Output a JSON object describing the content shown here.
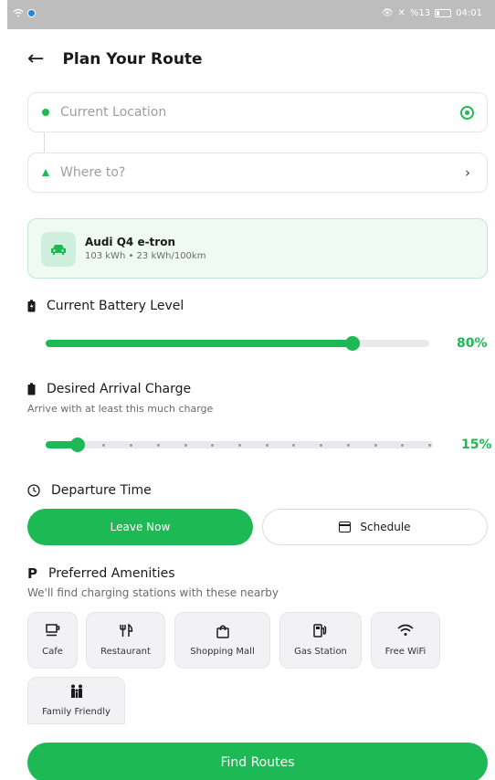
{
  "status_bar": {
    "right_text": "%13",
    "time": "04:01"
  },
  "header": {
    "title": "Plan Your Route",
    "back_icon": "arrow-left-icon"
  },
  "route": {
    "origin_placeholder": "Current Location",
    "destination_placeholder": "Where to?"
  },
  "vehicle": {
    "name": "Audi Q4 e-tron",
    "specs": "103 kWh • 23 kWh/100km"
  },
  "battery": {
    "title": "Current Battery Level",
    "value_label": "80%",
    "level": 0.8
  },
  "arrival": {
    "title": "Desired Arrival Charge",
    "subtitle": "Arrive with at least this much charge",
    "value_label": "15%",
    "level": 0.15
  },
  "departure": {
    "title": "Departure Time",
    "leave_now": "Leave Now",
    "schedule": "Schedule"
  },
  "amenities": {
    "title": "Preferred Amenities",
    "subtitle": "We'll find charging stations with these nearby",
    "items": [
      {
        "label": "Cafe",
        "icon": "coffee-icon"
      },
      {
        "label": "Restaurant",
        "icon": "restaurant-icon"
      },
      {
        "label": "Shopping Mall",
        "icon": "shopping-bag-icon"
      },
      {
        "label": "Gas Station",
        "icon": "gas-station-icon"
      },
      {
        "label": "Free WiFi",
        "icon": "wifi-icon"
      },
      {
        "label": "Family Friendly",
        "icon": "family-icon"
      }
    ]
  },
  "cta": {
    "find_routes": "Find Routes"
  },
  "colors": {
    "accent": "#1db954",
    "card_bg": "#eefaf2"
  }
}
